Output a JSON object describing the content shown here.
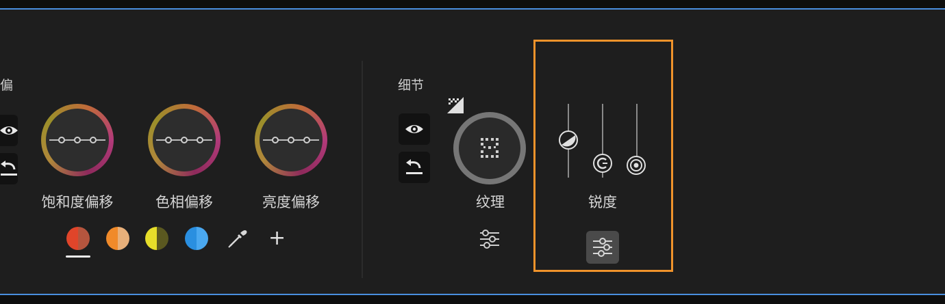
{
  "left_section": {
    "title_fragment": "偏",
    "wheels": [
      {
        "label": "饱和度偏移"
      },
      {
        "label": "色相偏移"
      },
      {
        "label": "亮度偏移"
      }
    ],
    "swatches": [
      {
        "name": "red",
        "left": "#e0452a",
        "right": "#b5553e",
        "selected": true
      },
      {
        "name": "orange",
        "left": "#f08a2a",
        "right": "#e8b07a",
        "selected": false
      },
      {
        "name": "yellow",
        "left": "#e6de2a",
        "right": "#5a5820",
        "selected": false
      },
      {
        "name": "blue",
        "left": "#2a8fe0",
        "right": "#4aa8f0",
        "selected": false
      }
    ],
    "add_label": "+"
  },
  "detail_section": {
    "title": "细节",
    "texture_label": "纹理",
    "sharpness_label": "锐度"
  },
  "colors": {
    "panel_bg": "#1e1e1e",
    "accent_border": "#4a8fe0",
    "highlight": "#f0932b"
  }
}
